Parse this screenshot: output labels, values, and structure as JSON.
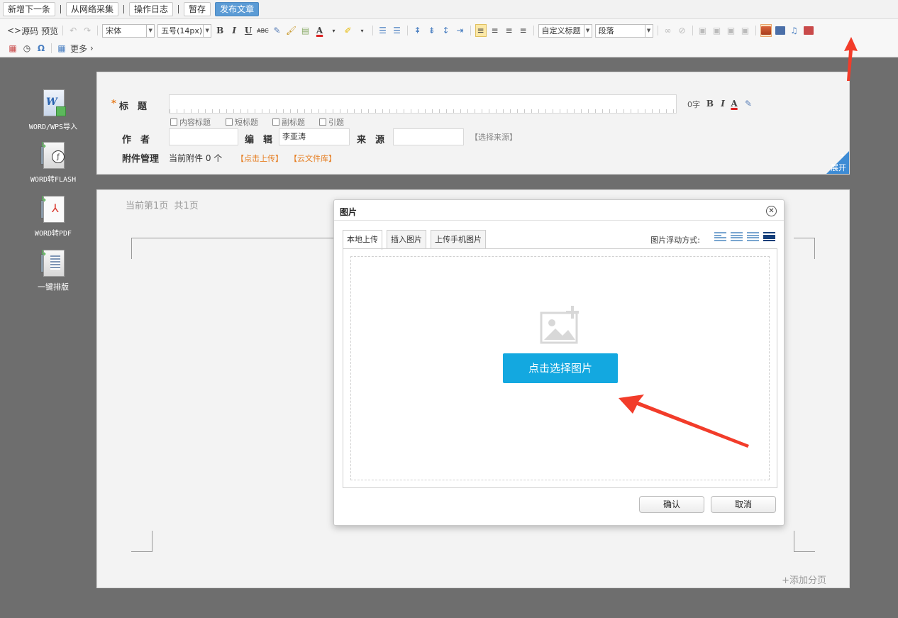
{
  "topbar": {
    "buttons": [
      "新增下一条",
      "从网络采集",
      "操作日志",
      "暂存",
      "发布文章"
    ]
  },
  "toolbar": {
    "source_label": "源码",
    "preview_label": "预览",
    "font_family": "宋体",
    "font_size": "五号(14px)",
    "custom_heading": "自定义标题",
    "paragraph": "段落",
    "more_label": "更多"
  },
  "sidebar": {
    "items": [
      {
        "label": "WORD/WPS导入",
        "icon": "word-import-icon"
      },
      {
        "label": "WORD转FLASH",
        "icon": "word-to-flash-icon"
      },
      {
        "label": "WORD转PDF",
        "icon": "word-to-pdf-icon"
      },
      {
        "label": "一键排版",
        "icon": "one-click-layout-icon"
      }
    ]
  },
  "form": {
    "required_mark": "*",
    "title_label": "标　题",
    "title_value": "",
    "char_count": "0字",
    "options": [
      "内容标题",
      "短标题",
      "副标题",
      "引题"
    ],
    "author_label": "作　者",
    "author_value": "",
    "editor_label": "编　辑",
    "editor_value": "李亚涛",
    "source_label": "来　源",
    "source_value": "",
    "choose_source": "【选择来源】",
    "attachment_label": "附件管理",
    "attachment_status": "当前附件 0 个",
    "upload_link": "【点击上传】",
    "cloud_link": "【云文件库】",
    "expand_label": "展开"
  },
  "page": {
    "indicator": "当前第1页  共1页",
    "add_page": "+添加分页"
  },
  "dialog": {
    "title": "图片",
    "tabs": [
      "本地上传",
      "插入图片",
      "上传手机图片"
    ],
    "float_label": "图片浮动方式:",
    "choose_button": "点击选择图片",
    "confirm": "确认",
    "cancel": "取消"
  },
  "colors": {
    "accent": "#13a8e0",
    "publish": "#5b9bd5",
    "arrow": "#f23c2a",
    "link_orange": "#e67e22"
  }
}
